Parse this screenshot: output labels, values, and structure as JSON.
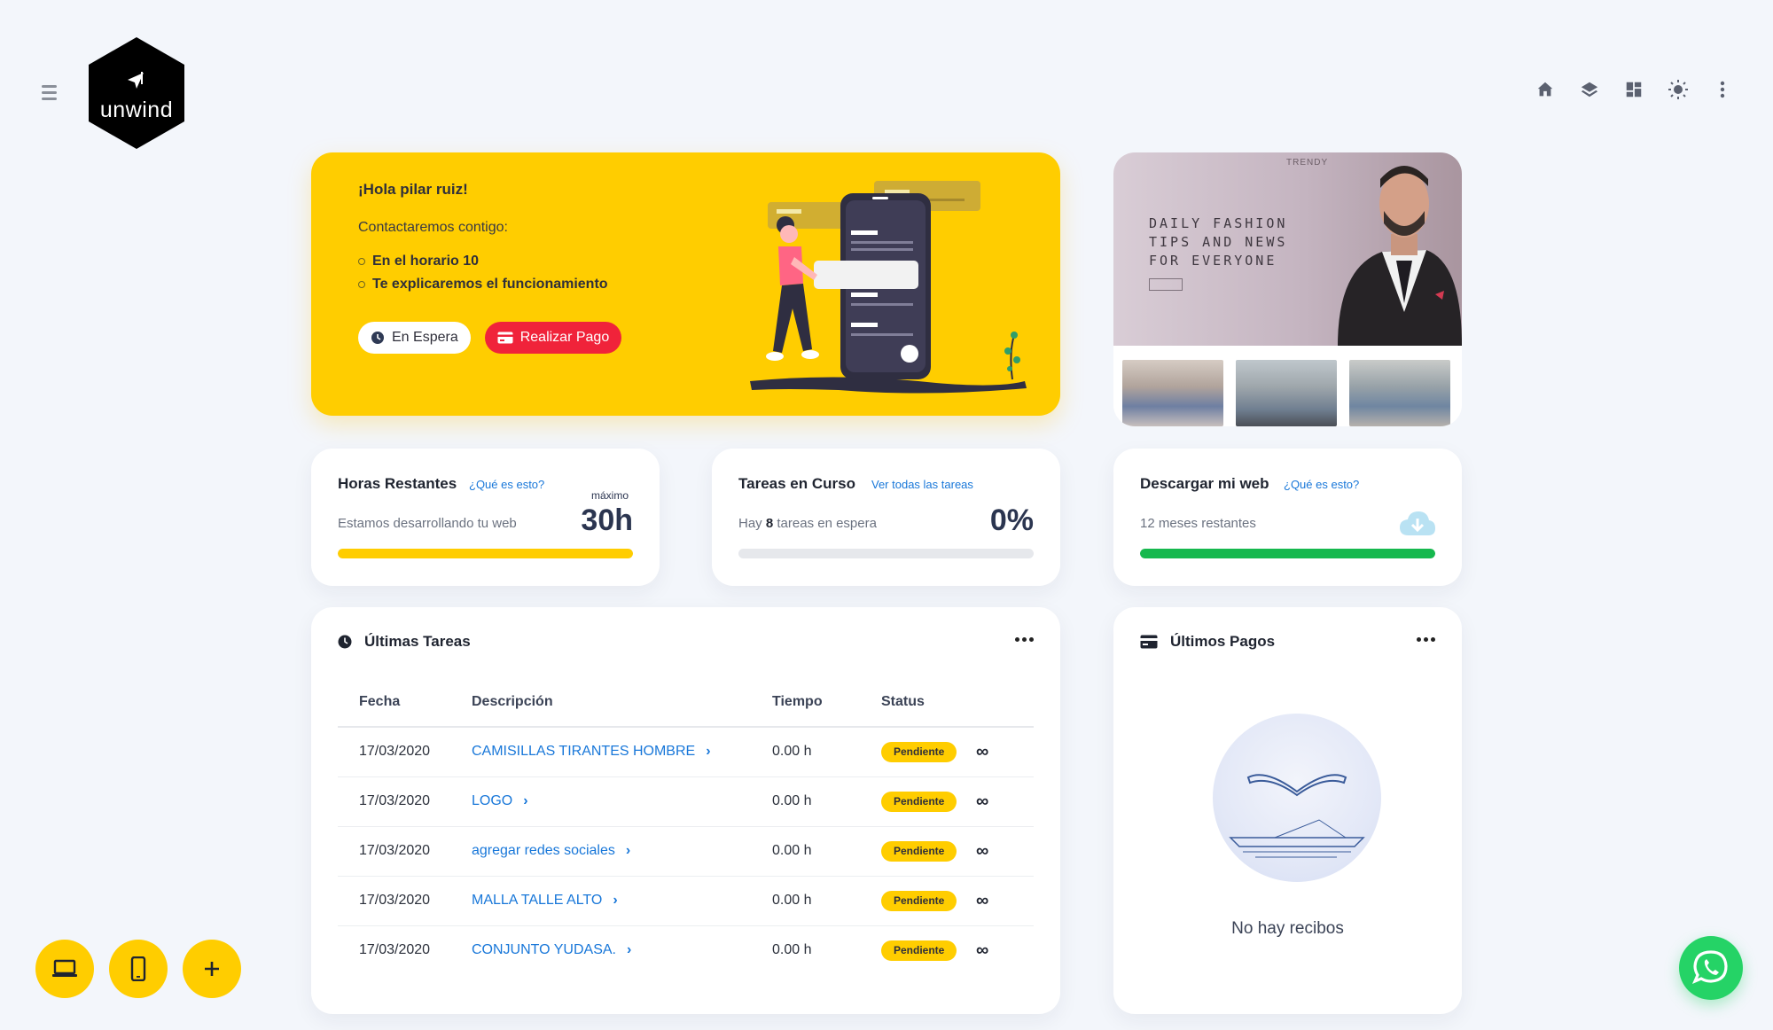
{
  "header": {
    "logo_text": "unwind",
    "icons": [
      "home-icon",
      "layers-icon",
      "dashboard-icon",
      "brightness-icon",
      "more-vertical-icon"
    ]
  },
  "hero": {
    "greeting": "¡Hola pilar ruiz!",
    "contact": "Contactaremos contigo:",
    "bullets": [
      "En el horario 10",
      "Te explicaremos el funcionamiento"
    ],
    "btn_wait": "En Espera",
    "btn_pay": "Realizar Pago"
  },
  "ad": {
    "brand": "TRENDY",
    "tagline": "DAILY FASHION TIPS AND NEWS FOR EVERYONE"
  },
  "hours": {
    "title": "Horas Restantes",
    "link": "¿Qué es esto?",
    "subtitle": "Estamos desarrollando tu web",
    "max_label": "máximo",
    "value": "30h",
    "progress": 1.0
  },
  "tareas": {
    "title": "Tareas en Curso",
    "link": "Ver todas las tareas",
    "sub_prefix": "Hay",
    "count": "8",
    "sub_suffix": "tareas en espera",
    "percent": "0%",
    "progress": 0
  },
  "download": {
    "title": "Descargar mi web",
    "link": "¿Qué es esto?",
    "subtitle": "12 meses restantes",
    "progress": 1.0
  },
  "tasks": {
    "title": "Últimas Tareas",
    "columns": [
      "Fecha",
      "Descripción",
      "Tiempo",
      "Status"
    ],
    "rows": [
      {
        "date": "17/03/2020",
        "desc": "CAMISILLAS TIRANTES HOMBRE",
        "time": "0.00 h",
        "status": "Pendiente"
      },
      {
        "date": "17/03/2020",
        "desc": "LOGO",
        "time": "0.00 h",
        "status": "Pendiente"
      },
      {
        "date": "17/03/2020",
        "desc": "agregar redes sociales",
        "time": "0.00 h",
        "status": "Pendiente"
      },
      {
        "date": "17/03/2020",
        "desc": "MALLA TALLE ALTO",
        "time": "0.00 h",
        "status": "Pendiente"
      },
      {
        "date": "17/03/2020",
        "desc": "CONJUNTO YUDASA.",
        "time": "0.00 h",
        "status": "Pendiente"
      }
    ]
  },
  "payments": {
    "title": "Últimos Pagos",
    "empty": "No hay recibos"
  },
  "colors": {
    "accent": "#ffcd00",
    "danger": "#f0233a",
    "link": "#1877d9",
    "success": "#16b84e",
    "whatsapp": "#25d366"
  }
}
